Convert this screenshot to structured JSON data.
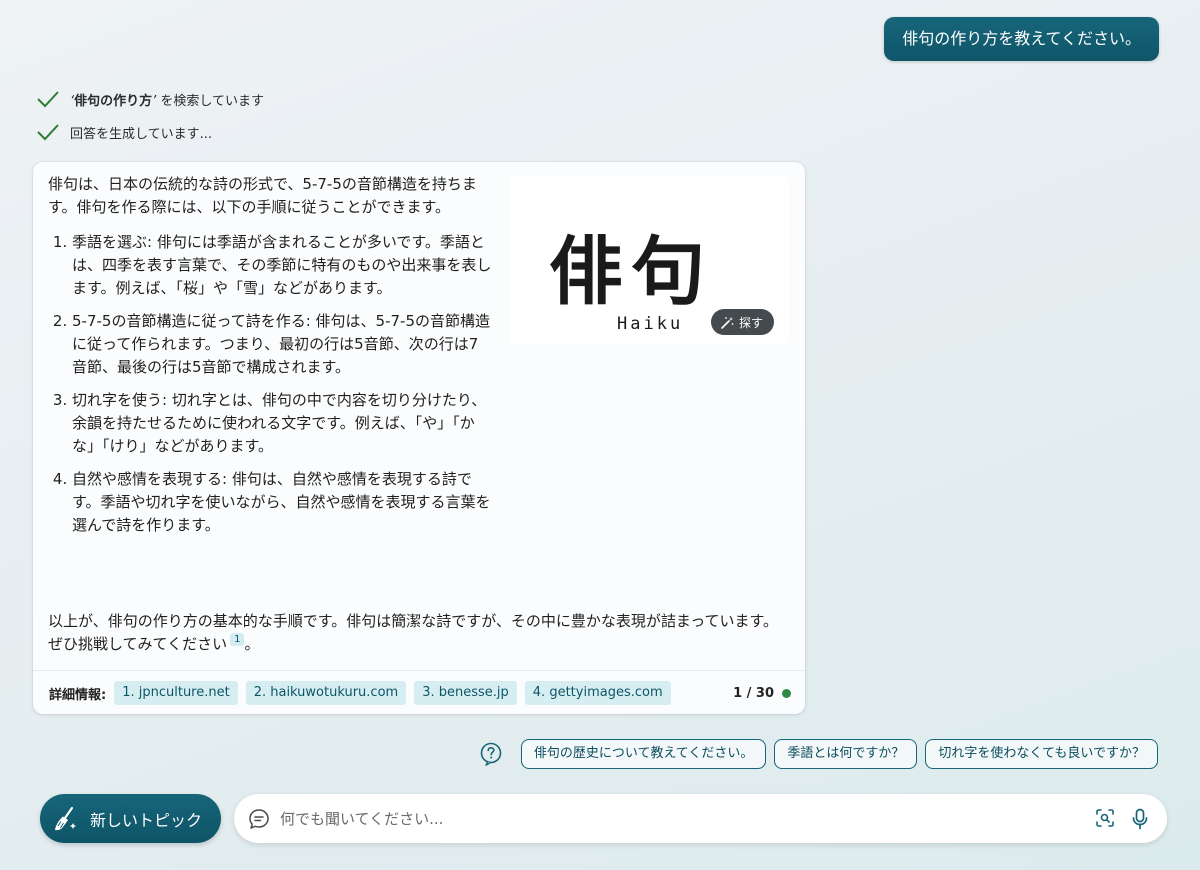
{
  "user_message": "俳句の作り方を教えてください。",
  "progress": {
    "search": {
      "quote_open": "‘",
      "query": "俳句の作り方",
      "quote_close": "’",
      "suffix": " を検索しています"
    },
    "generate": "回答を生成しています..."
  },
  "answer": {
    "intro": "俳句は、日本の伝統的な詩の形式で、5-7-5の音節構造を持ちます。俳句を作る際には、以下の手順に従うことができます。",
    "steps": [
      "季語を選ぶ: 俳句には季語が含まれることが多いです。季語とは、四季を表す言葉で、その季節に特有のものや出来事を表します。例えば、「桜」や「雪」などがあります。",
      "5-7-5の音節構造に従って詩を作る: 俳句は、5-7-5の音節構造に従って作られます。つまり、最初の行は5音節、次の行は7音節、最後の行は5音節で構成されます。",
      "切れ字を使う: 切れ字とは、俳句の中で内容を切り分けたり、余韻を持たせるために使われる文字です。例えば、「や」「かな」「けり」などがあります。",
      "自然や感情を表現する: 俳句は、自然や感情を表現する詩です。季語や切れ字を使いながら、自然や感情を表現する言葉を選んで詩を作ります。"
    ],
    "conclusion": "以上が、俳句の作り方の基本的な手順です。俳句は簡潔な詩ですが、その中に豊かな表現が詰まっています。ぜひ挑戦してみてください",
    "citation": "1",
    "conclusion_end": "。"
  },
  "image": {
    "kanji": "俳句",
    "romaji": "Haiku",
    "search_button": "探す"
  },
  "sources": {
    "label": "詳細情報:",
    "items": [
      "1. jpnculture.net",
      "2. haikuwotukuru.com",
      "3. benesse.jp",
      "4. gettyimages.com"
    ]
  },
  "turn_counter": "1 / 30",
  "suggestions": [
    "俳句の歴史について教えてください。",
    "季語とは何ですか？",
    "切れ字を使わなくても良いですか？"
  ],
  "new_topic_label": "新しいトピック",
  "input": {
    "placeholder": "何でも聞いてください..."
  },
  "colors": {
    "accent": "#17657a",
    "chip_bg": "#d6eef2",
    "status_dot": "#2e8b47",
    "check": "#2e7d32"
  },
  "icons": [
    "check-icon",
    "wand-icon",
    "help-icon",
    "broom-icon",
    "chat-icon",
    "visual-search-icon",
    "microphone-icon"
  ]
}
